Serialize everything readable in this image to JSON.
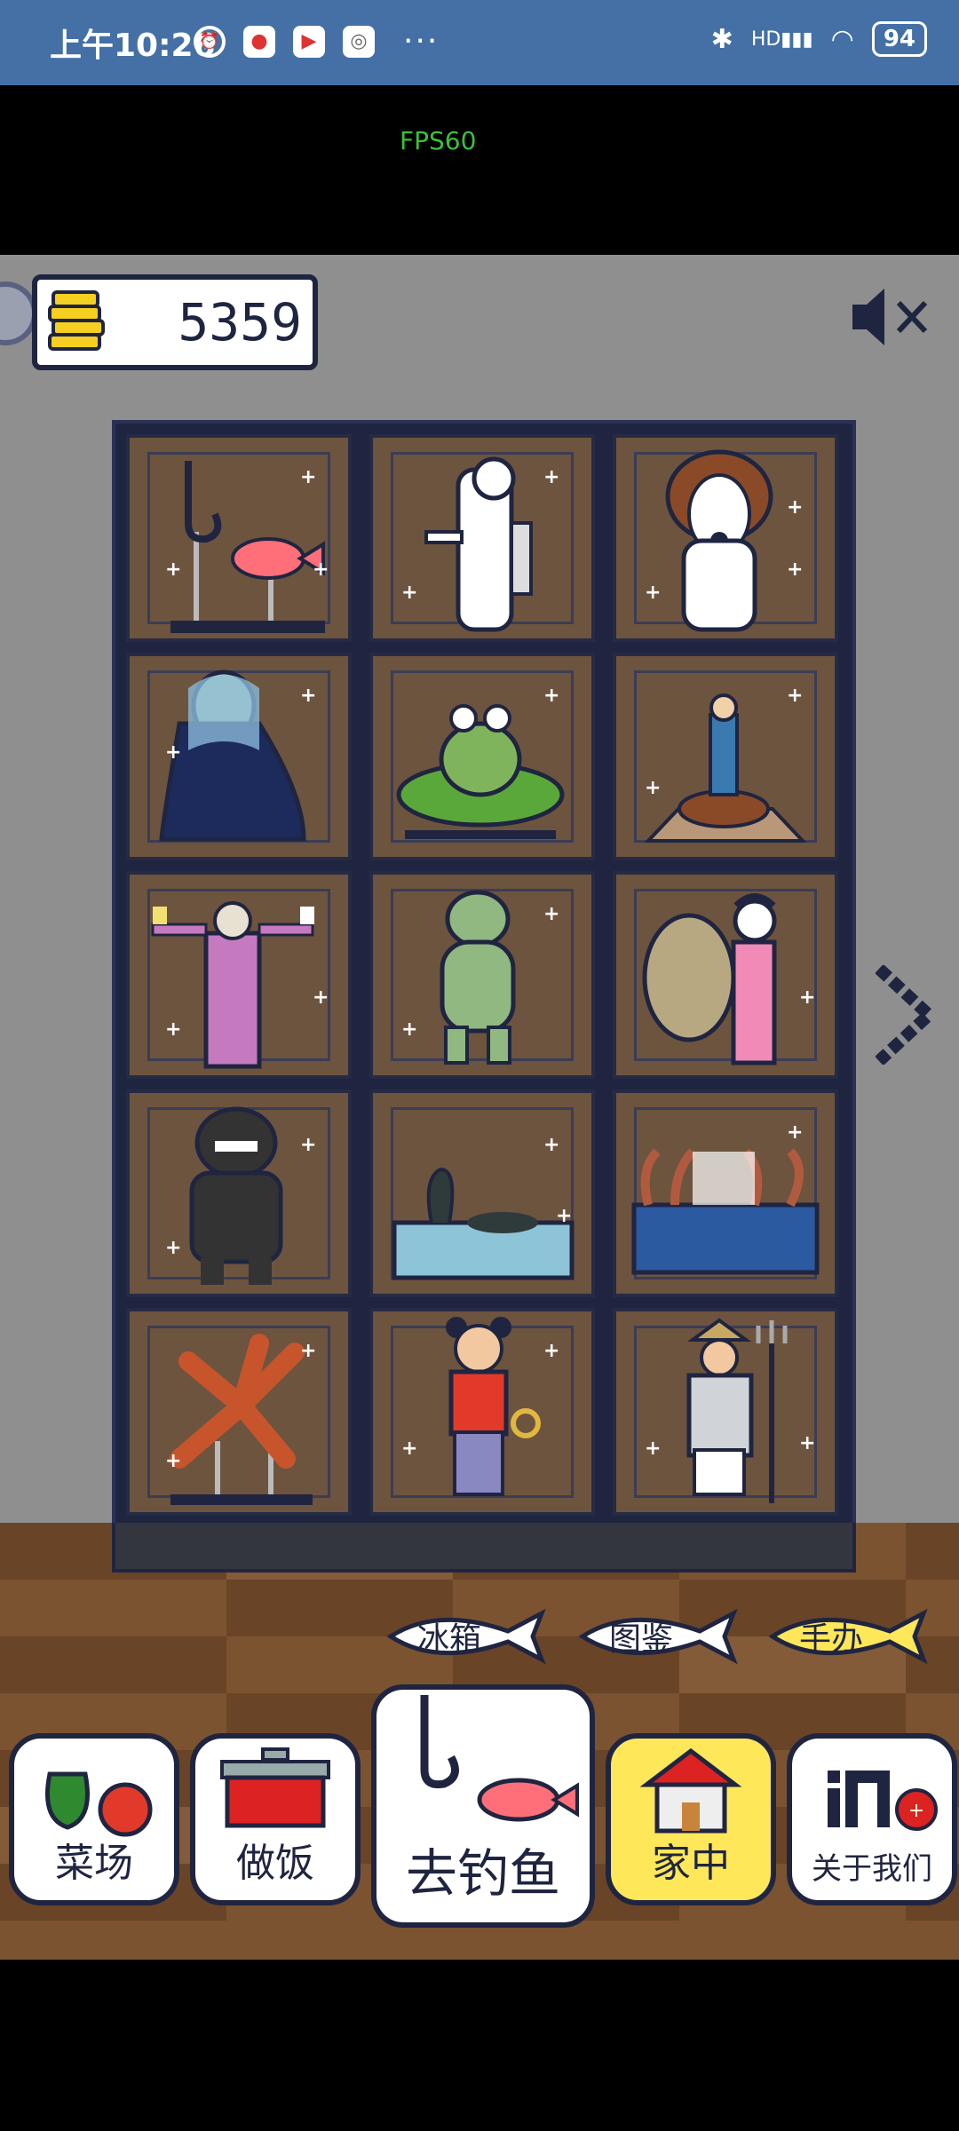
{
  "status_bar": {
    "time": "上午10:26",
    "battery": "94",
    "signal": "HD",
    "more": "···"
  },
  "overlay": {
    "fps": "FPS60"
  },
  "hud": {
    "coins": "5359"
  },
  "cabinet": {
    "items": [
      {
        "name": "display-fish-on-hook"
      },
      {
        "name": "display-white-creature"
      },
      {
        "name": "display-beagle-dog"
      },
      {
        "name": "display-ghost-woman"
      },
      {
        "name": "display-frog-on-lilypad"
      },
      {
        "name": "display-small-figure-on-stand"
      },
      {
        "name": "display-old-man-purple-robe"
      },
      {
        "name": "display-green-frog-man"
      },
      {
        "name": "display-snail-shell-and-lady"
      },
      {
        "name": "display-black-monster"
      },
      {
        "name": "display-sea-serpent-in-water"
      },
      {
        "name": "display-octopus-tentacles-in-tank"
      },
      {
        "name": "display-red-starfish"
      },
      {
        "name": "display-girl-with-buns"
      },
      {
        "name": "display-fisherman-with-trident"
      }
    ]
  },
  "tabs": [
    {
      "label": "冰箱",
      "active": false
    },
    {
      "label": "图鉴",
      "active": false
    },
    {
      "label": "手办",
      "active": true
    }
  ],
  "nav": [
    {
      "label": "菜场"
    },
    {
      "label": "做饭"
    },
    {
      "label": "去钓鱼"
    },
    {
      "label": "家中"
    },
    {
      "label": "关于我们"
    }
  ],
  "colors": {
    "statusbar": "#4470a6",
    "game_bg": "#8f8f8f",
    "cabinet_frame": "#1f2540",
    "cell_bg": "#6d543f",
    "active": "#ffe75a"
  }
}
